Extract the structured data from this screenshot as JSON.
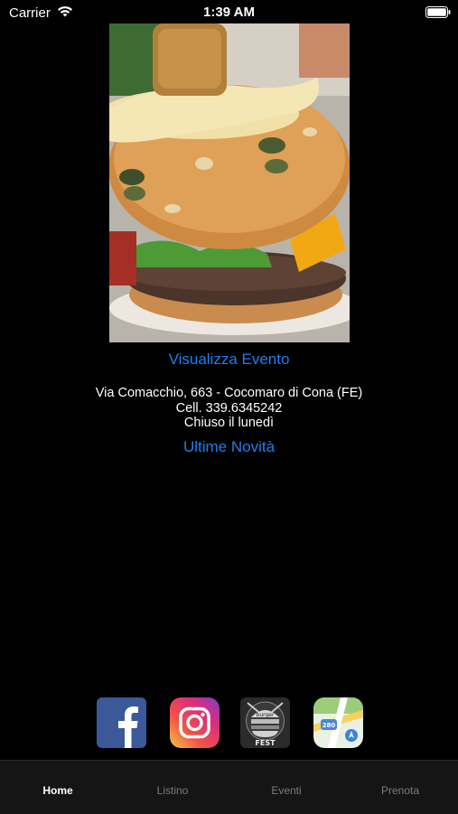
{
  "status_bar": {
    "carrier": "Carrier",
    "time": "1:39 AM"
  },
  "hero": {
    "image_icon": "burger-photo"
  },
  "links": {
    "event": "Visualizza Evento",
    "news": "Ultime Novità"
  },
  "info": {
    "address": "Via Comacchio, 663 - Cocomaro di Cona (FE)",
    "phone": "Cell. 339.6345242",
    "closed": "Chiuso il lunedì"
  },
  "social": {
    "facebook_icon": "facebook-icon",
    "instagram_icon": "instagram-icon",
    "burger_fest_icon": "burger-fest-logo",
    "maps_icon": "maps-icon",
    "badge_text": "FEST",
    "badge_top": "burger",
    "map_shield": "280"
  },
  "tabs": [
    {
      "label": "Home"
    },
    {
      "label": "Listino"
    },
    {
      "label": "Eventi"
    },
    {
      "label": "Prenota"
    }
  ],
  "colors": {
    "link": "#1e7ff0",
    "tab_active": "#ffffff",
    "tab_inactive": "#7b7b7b",
    "facebook": "#3b5998"
  }
}
